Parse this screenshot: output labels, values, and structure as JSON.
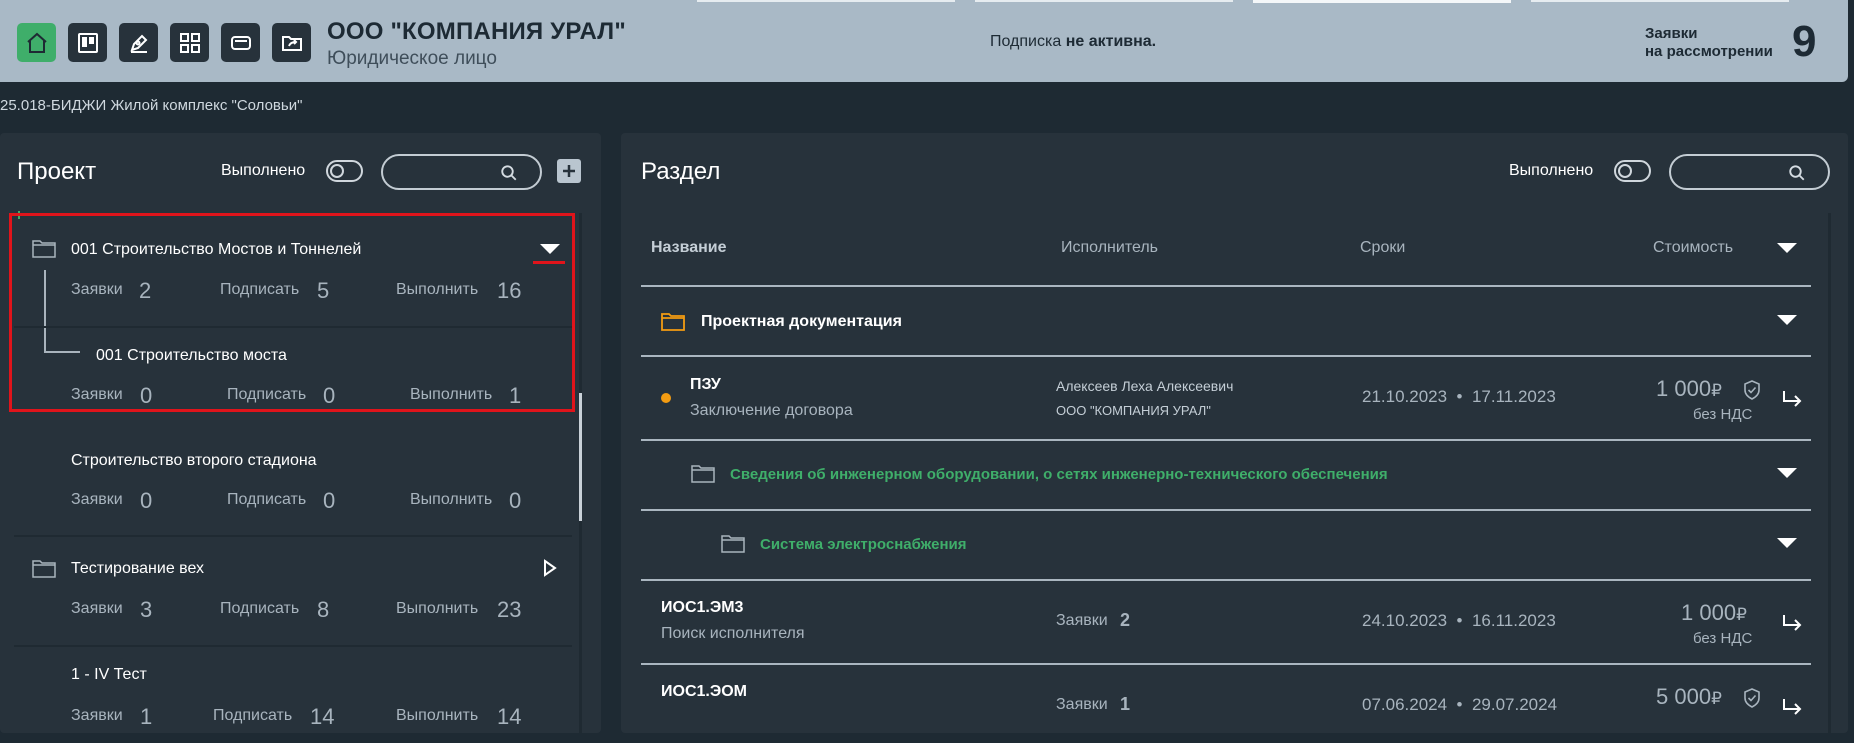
{
  "header": {
    "company_name": "ООО \"КОМПАНИЯ УРАЛ\"",
    "company_type": "Юридическое лицо",
    "subscription_prefix": "Подписка ",
    "subscription_status": "не активна.",
    "applications_line1": "Заявки",
    "applications_line2": "на рассмотрении",
    "applications_count": "9",
    "toolbar_icons": [
      "home-icon",
      "kanban-icon",
      "pen-icon",
      "grid-icon",
      "card-icon",
      "folder-share-icon"
    ],
    "accent_color": "#3fae6a"
  },
  "breadcrumb": "25.018-БИДЖИ Жилой комплекс \"Соловьи\"",
  "left_panel": {
    "title": "Проект",
    "done_label": "Выполнено",
    "search_placeholder": "",
    "projects": [
      {
        "name": "001 Строительство Мостов и Тоннелей",
        "stats": {
          "apps_label": "Заявки",
          "apps": "2",
          "sign_label": "Подписать",
          "sign": "5",
          "do_label": "Выполнить",
          "do": "16"
        },
        "child": {
          "name": "001 Строительство моста",
          "stats": {
            "apps_label": "Заявки",
            "apps": "0",
            "sign_label": "Подписать",
            "sign": "0",
            "do_label": "Выполнить",
            "do": "1"
          }
        }
      },
      {
        "name": "Строительство второго стадиона",
        "stats": {
          "apps_label": "Заявки",
          "apps": "0",
          "sign_label": "Подписать",
          "sign": "0",
          "do_label": "Выполнить",
          "do": "0"
        }
      },
      {
        "name": "Тестирование вех",
        "stats": {
          "apps_label": "Заявки",
          "apps": "3",
          "sign_label": "Подписать",
          "sign": "8",
          "do_label": "Выполнить",
          "do": "23"
        }
      },
      {
        "name": "1 - IV Тест",
        "stats": {
          "apps_label": "Заявки",
          "apps": "1",
          "sign_label": "Подписать",
          "sign": "14",
          "do_label": "Выполнить",
          "do": "14"
        }
      }
    ]
  },
  "right_panel": {
    "title": "Раздел",
    "done_label": "Выполнено",
    "columns": {
      "name": "Название",
      "executor": "Исполнитель",
      "terms": "Сроки",
      "cost": "Стоимость"
    },
    "groups": [
      {
        "name": "Проектная документация",
        "color": "#ffffff"
      },
      {
        "name": "Сведения об инженерном оборудовании, о сетях инженерно-технического обеспечения",
        "color": "#3fae6a"
      },
      {
        "name": "Система электроснабжения",
        "color": "#3fae6a"
      }
    ],
    "rows": [
      {
        "code": "ПЗУ",
        "status": "Заключение договора",
        "executor_name": "Алексеев Леха Алексеевич",
        "executor_org": "ООО \"КОМПАНИЯ УРАЛ\"",
        "date_start": "21.10.2023",
        "date_end": "17.11.2023",
        "cost": "1 000",
        "currency": "₽",
        "vat": "без НДС"
      },
      {
        "code": "ИОС1.ЭМ3",
        "status": "Поиск исполнителя",
        "apps_label": "Заявки",
        "apps_count": "2",
        "date_start": "24.10.2023",
        "date_end": "16.11.2023",
        "cost": "1 000",
        "currency": "₽",
        "vat": "без НДС"
      },
      {
        "code": "ИОС1.ЭОМ",
        "status": "",
        "apps_label": "Заявки",
        "apps_count": "1",
        "date_start": "07.06.2024",
        "date_end": "29.07.2024",
        "cost": "5 000",
        "currency": "₽"
      }
    ],
    "date_sep": "•",
    "status_dot_color": "#f39c12"
  }
}
